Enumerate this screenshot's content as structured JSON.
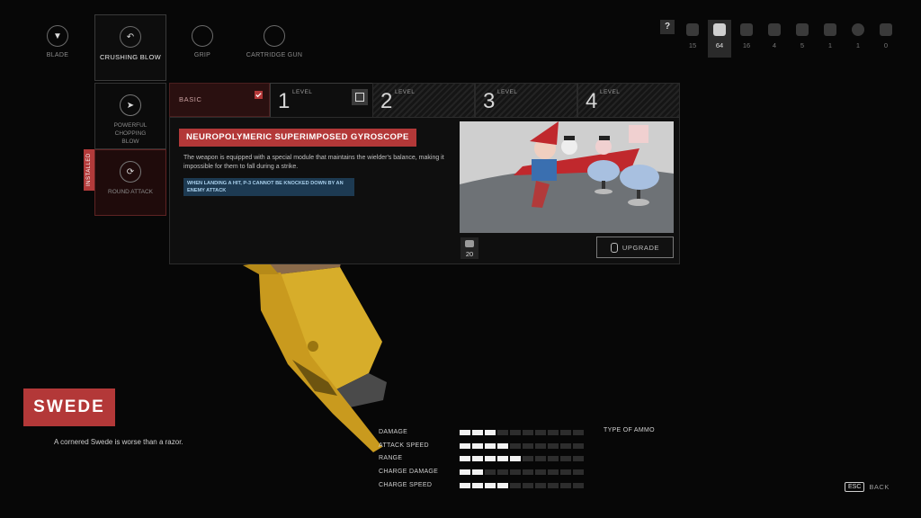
{
  "categories": [
    {
      "label": "BLADE",
      "icon": "blade-icon"
    },
    {
      "label": "CRUSHING BLOW",
      "icon": "crushing-blow-icon"
    },
    {
      "label": "GRIP",
      "icon": "grip-icon"
    },
    {
      "label": "CARTRIDGE GUN",
      "icon": "cartridge-gun-icon"
    }
  ],
  "modules": [
    {
      "label": "POWERFUL CHOPPING BLOW"
    },
    {
      "label": "ROUND ATTACK",
      "badge": "INSTALLED"
    }
  ],
  "levels": {
    "basic": "BASIC",
    "word": "LEVEL",
    "items": [
      "1",
      "2",
      "3",
      "4"
    ]
  },
  "panel": {
    "title": "NEUROPOLYMERIC SUPERIMPOSED GYROSCOPE",
    "description": "The weapon is equipped with a special module that maintains the wielder's balance, making it impossible for them to fall during a strike.",
    "effect": "WHEN LANDING A HIT, P-3 CANNOT BE KNOCKED DOWN BY AN ENEMY ATTACK",
    "cost": "20",
    "upgrade_label": "UPGRADE"
  },
  "help": "?",
  "resources": [
    "15",
    "64",
    "16",
    "4",
    "5",
    "1",
    "1",
    "0"
  ],
  "weapon": {
    "name": "SWEDE",
    "tagline": "A cornered Swede is worse than a razor."
  },
  "stats": [
    {
      "label": "DAMAGE",
      "filled": 3,
      "total": 10
    },
    {
      "label": "ATTACK SPEED",
      "filled": 4,
      "total": 10
    },
    {
      "label": "RANGE",
      "filled": 5,
      "total": 10
    },
    {
      "label": "CHARGE DAMAGE",
      "filled": 2,
      "total": 10
    },
    {
      "label": "CHARGE SPEED",
      "filled": 4,
      "total": 10
    }
  ],
  "ammo_label": "TYPE OF AMMO",
  "esc": {
    "key": "ESC",
    "label": "BACK"
  },
  "colors": {
    "accent": "#b33838",
    "effect_bg": "#1d3a52",
    "gold": "#d4a820"
  }
}
